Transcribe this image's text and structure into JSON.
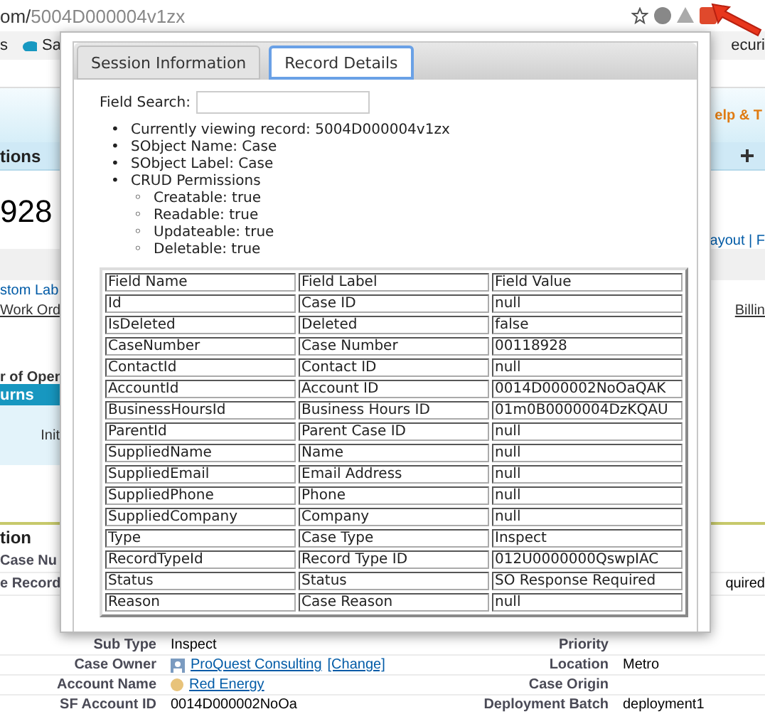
{
  "browser": {
    "url_host": "om/",
    "url_path": "5004D000004v1zx",
    "bookmarks": [
      "s",
      "Sa"
    ],
    "bookmark_right": "ecuri"
  },
  "page": {
    "help_link": "elp & T",
    "nav_tab": "tions",
    "record_number": "928",
    "layout_links": "ayout | F",
    "custom_link": "stom Lab",
    "work_link": "Work Ord",
    "billing_link": "Billin",
    "list_label": "r of Open",
    "related_header": "urns",
    "related_cell": "Init",
    "section_title": "tion",
    "fields": [
      {
        "label": "Case Nu"
      },
      {
        "label": "e Record",
        "value": "quired"
      }
    ]
  },
  "details": [
    {
      "label": "Sub Type",
      "value": "Inspect",
      "kind": "text",
      "label2": "Priority"
    },
    {
      "label": "Case Owner",
      "value": "ProQuest Consulting",
      "action": "[Change]",
      "kind": "owner",
      "label2": "Location",
      "value2": "Metro"
    },
    {
      "label": "Account Name",
      "value": "Red Energy",
      "kind": "account",
      "label2": "Case Origin"
    },
    {
      "label": "SF Account ID",
      "value": "0014D000002NoOa",
      "kind": "text",
      "label2": "Deployment Batch",
      "value2": "deployment1"
    }
  ],
  "popup": {
    "tabs": [
      {
        "label": "Session Information",
        "selected": false
      },
      {
        "label": "Record Details",
        "selected": true
      }
    ],
    "field_search": {
      "label": "Field Search:"
    },
    "bullet": "•",
    "sub_bullet": "◦",
    "info": [
      "Currently viewing record: 5004D000004v1zx",
      "SObject Name: Case",
      "SObject Label: Case"
    ],
    "crud_title": "CRUD Permissions",
    "crud": [
      "Creatable: true",
      "Readable: true",
      "Updateable: true",
      "Deletable: true"
    ],
    "table": {
      "columns": [
        "Field Name",
        "Field Label",
        "Field Value"
      ],
      "rows": [
        [
          "Id",
          "Case ID",
          "null"
        ],
        [
          "IsDeleted",
          "Deleted",
          "false"
        ],
        [
          "CaseNumber",
          "Case Number",
          "00118928"
        ],
        [
          "ContactId",
          "Contact ID",
          "null"
        ],
        [
          "AccountId",
          "Account ID",
          "0014D000002NoOaQAK"
        ],
        [
          "BusinessHoursId",
          "Business Hours ID",
          "01m0B0000004DzKQAU"
        ],
        [
          "ParentId",
          "Parent Case ID",
          "null"
        ],
        [
          "SuppliedName",
          "Name",
          "null"
        ],
        [
          "SuppliedEmail",
          "Email Address",
          "null"
        ],
        [
          "SuppliedPhone",
          "Phone",
          "null"
        ],
        [
          "SuppliedCompany",
          "Company",
          "null"
        ],
        [
          "Type",
          "Case Type",
          "Inspect"
        ],
        [
          "RecordTypeId",
          "Record Type ID",
          "012U0000000QswpIAC"
        ],
        [
          "Status",
          "Status",
          "SO Response Required"
        ],
        [
          "Reason",
          "Case Reason",
          "null"
        ]
      ]
    }
  }
}
